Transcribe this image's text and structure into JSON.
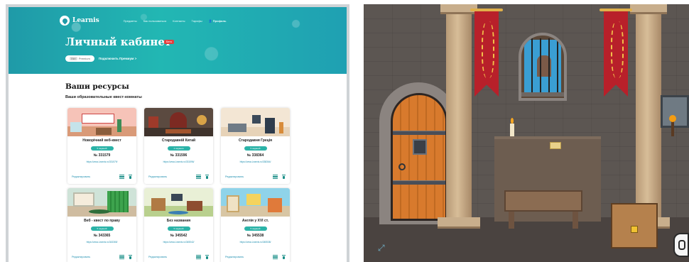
{
  "left": {
    "nav": {
      "logo": "Learnis",
      "links": [
        "Предметы",
        "Как пользоваться",
        "Контакты",
        "Тарифы"
      ],
      "profile": "Профиль"
    },
    "hero": {
      "title": "Личный кабинет",
      "beta": "Бета",
      "pill_tag": "Нет",
      "pill_text": "Premium",
      "premium_link": "Подключить Премиум >"
    },
    "section_title": "Ваши ресурсы",
    "section_subtitle": "Ваши образовательные квест-комнаты",
    "edit_label": "Редактировать",
    "cards": [
      {
        "title": "Новорічний веб-квест",
        "badge": "5 заданий",
        "number": "№ 331579",
        "url": "https://www.Learnis.ru/331579/"
      },
      {
        "title": "Стародавній Китай",
        "badge": "4 задания",
        "number": "№ 331596",
        "url": "https://www.Learnis.ru/331596/"
      },
      {
        "title": "Стародавня Греція",
        "badge": "5 заданий",
        "number": "№ 338364",
        "url": "https://www.Learnis.ru/338364/"
      },
      {
        "title": "Веб - квест по праву",
        "badge": "5 заданий",
        "number": "№ 343365",
        "url": "https://www.Learnis.ru/343365/"
      },
      {
        "title": "Без названия",
        "badge": "5 заданий",
        "number": "№ 345542",
        "url": "https://www.Learnis.ru/345542/"
      },
      {
        "title": "Англія у XVI ст.",
        "badge": "5 заданий",
        "number": "№ 345538",
        "url": "https://www.Learnis.ru/345538/"
      }
    ]
  },
  "game": {
    "icons": [
      "fullscreen-icon",
      "backpack-icon"
    ]
  },
  "colors": {
    "brand": "#22b7b3",
    "badge": "#2bb3a8",
    "link": "#1f8fb0",
    "beta": "#e53e3e"
  }
}
